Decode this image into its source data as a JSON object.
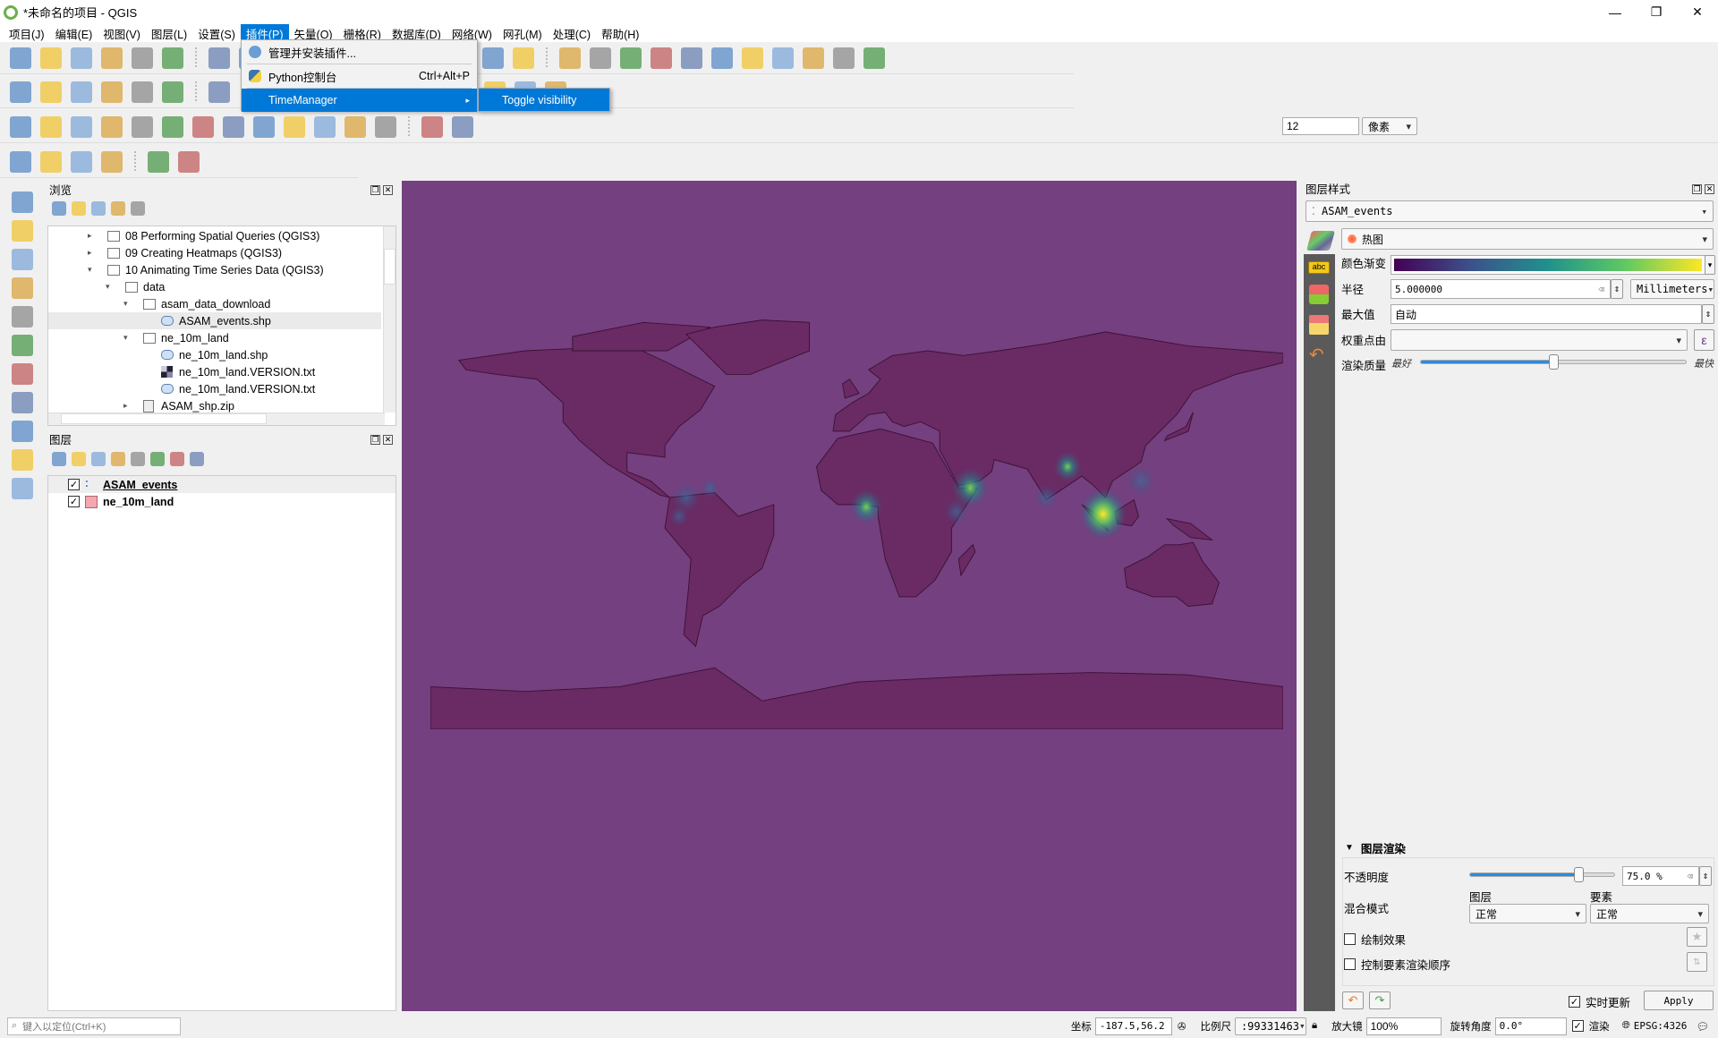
{
  "window": {
    "title": "*未命名的项目 - QGIS",
    "controls": [
      "—",
      "❐",
      "✕"
    ]
  },
  "menubar": [
    "项目(J)",
    "编辑(E)",
    "视图(V)",
    "图层(L)",
    "设置(S)",
    "插件(P)",
    "矢量(O)",
    "栅格(R)",
    "数据库(D)",
    "网络(W)",
    "网孔(M)",
    "处理(C)",
    "帮助(H)"
  ],
  "plugin_menu": {
    "items": [
      {
        "label": "管理并安装插件...",
        "shortcut": ""
      },
      {
        "label": "Python控制台",
        "shortcut": "Ctrl+Alt+P"
      },
      {
        "label": "TimeManager",
        "shortcut": "▸"
      }
    ],
    "submenu": [
      "Toggle visibility"
    ]
  },
  "toolbars": {
    "row1": [
      "new-project",
      "open-project",
      "save-project",
      "new-print-layout",
      "layout-manager",
      "style-manager",
      "sep",
      "pan",
      "pan-to-selection",
      "zoom-in",
      "zoom-out",
      "zoom-full",
      "zoom-layer",
      "zoom-last",
      "zoom-next",
      "new-bookmark",
      "show-bookmarks",
      "refresh",
      "sep",
      "identify",
      "run-feature-action",
      "select-features",
      "deselect",
      "open-attribute-table",
      "statistics",
      "field-calculator",
      "measure",
      "sum",
      "annotation",
      "text-annotation"
    ],
    "row2": [
      "data-source-manager",
      "new-geopackage",
      "new-shapefile",
      "new-spatialite",
      "new-virtual-layer",
      "new-temporary-layer",
      "sep",
      "digitize",
      "sep",
      "label-tool",
      "pin-labels",
      "show-labels",
      "move-label",
      "rotate-label",
      "change-label",
      "sep",
      "db-manager",
      "grass",
      "python",
      "help"
    ],
    "row3": [
      "digitize-tools",
      "add-ring",
      "add-part",
      "fill-ring",
      "delete-ring",
      "delete-part",
      "reshape",
      "offset-curve",
      "split-features",
      "split-parts",
      "merge-selected",
      "merge-attributes",
      "rotate-symbols",
      "sep",
      "snapping",
      "tracing"
    ],
    "row4": [
      "processing-toolbox",
      "select-by-expression",
      "select-by-location",
      "select-by-value",
      "sep",
      "zoom-selected",
      "georeferencer"
    ],
    "snap_value": "12",
    "snap_unit": "像素"
  },
  "left_toolbar": [
    "add-vector-layer",
    "add-raster-layer",
    "add-mesh-layer",
    "add-delimited-text",
    "add-spatialite",
    "add-virtual-layer",
    "add-wms",
    "add-wcs",
    "add-wfs",
    "add-arcgis",
    "add-postgis"
  ],
  "browser": {
    "title": "浏览",
    "tools": [
      "add-selected",
      "refresh",
      "filter",
      "collapse-all",
      "info"
    ],
    "items": [
      {
        "label": "08 Performing Spatial Queries (QGIS3)",
        "depth": 0,
        "arrow": "▸",
        "icon": "folder"
      },
      {
        "label": "09 Creating Heatmaps (QGIS3)",
        "depth": 0,
        "arrow": "▸",
        "icon": "folder"
      },
      {
        "label": "10 Animating Time Series Data (QGIS3)",
        "depth": 0,
        "arrow": "▾",
        "icon": "folder"
      },
      {
        "label": "data",
        "depth": 1,
        "arrow": "▾",
        "icon": "folder"
      },
      {
        "label": "asam_data_download",
        "depth": 2,
        "arrow": "▾",
        "icon": "folder"
      },
      {
        "label": "ASAM_events.shp",
        "depth": 3,
        "arrow": "",
        "icon": "vector",
        "selected": true
      },
      {
        "label": "ne_10m_land",
        "depth": 2,
        "arrow": "▾",
        "icon": "folder"
      },
      {
        "label": "ne_10m_land.shp",
        "depth": 3,
        "arrow": "",
        "icon": "vector"
      },
      {
        "label": "ne_10m_land.VERSION.txt",
        "depth": 3,
        "arrow": "",
        "icon": "raster"
      },
      {
        "label": "ne_10m_land.VERSION.txt",
        "depth": 3,
        "arrow": "",
        "icon": "vector"
      },
      {
        "label": "ASAM_shp.zip",
        "depth": 2,
        "arrow": "▸",
        "icon": "zip"
      }
    ]
  },
  "layers": {
    "title": "图层",
    "tools": [
      "style",
      "add-group",
      "visibility",
      "filter",
      "expression",
      "expand",
      "collapse",
      "remove"
    ],
    "items": [
      {
        "label": "ASAM_events",
        "checked": true,
        "symbol": "points"
      },
      {
        "label": "ne_10m_land",
        "checked": true,
        "symbol": "#f4a7b0"
      }
    ]
  },
  "map": {
    "background": "#74407f",
    "land": "#6a2a63"
  },
  "style_panel": {
    "title": "图层样式",
    "layer": "ASAM_events",
    "renderer": "热图",
    "labels": {
      "ramp": "颜色渐变",
      "radius": "半径",
      "max": "最大值",
      "weight": "权重点由",
      "quality": "渲染质量",
      "best": "最好",
      "fast": "最快"
    },
    "radius_value": "5.000000",
    "radius_unit": "Millimeters",
    "max_value": "自动",
    "weight_value": "",
    "quality_level": 0.5,
    "ramp_colors": [
      "#440154",
      "#3b528b",
      "#21918c",
      "#5ec962",
      "#fde725"
    ],
    "render": {
      "title": "图层渲染",
      "opacity_label": "不透明度",
      "opacity_value": "75.0 %",
      "opacity": 0.75,
      "blend_label": "混合模式",
      "layer_label": "图层",
      "feature_label": "要素",
      "layer_blend": "正常",
      "feature_blend": "正常",
      "effects": "绘制效果",
      "order": "控制要素渲染顺序"
    },
    "live_update": "实时更新",
    "apply": "Apply"
  },
  "status": {
    "locate_placeholder": "键入以定位(Ctrl+K)",
    "coord_label": "坐标",
    "coord": "-187.5,56.2",
    "scale_label": "比例尺",
    "scale": ":99331463",
    "magnifier_label": "放大镜",
    "magnifier": "100%",
    "rotation_label": "旋转角度",
    "rotation": "0.0°",
    "render_label": "渲染",
    "crs": "EPSG:4326"
  }
}
